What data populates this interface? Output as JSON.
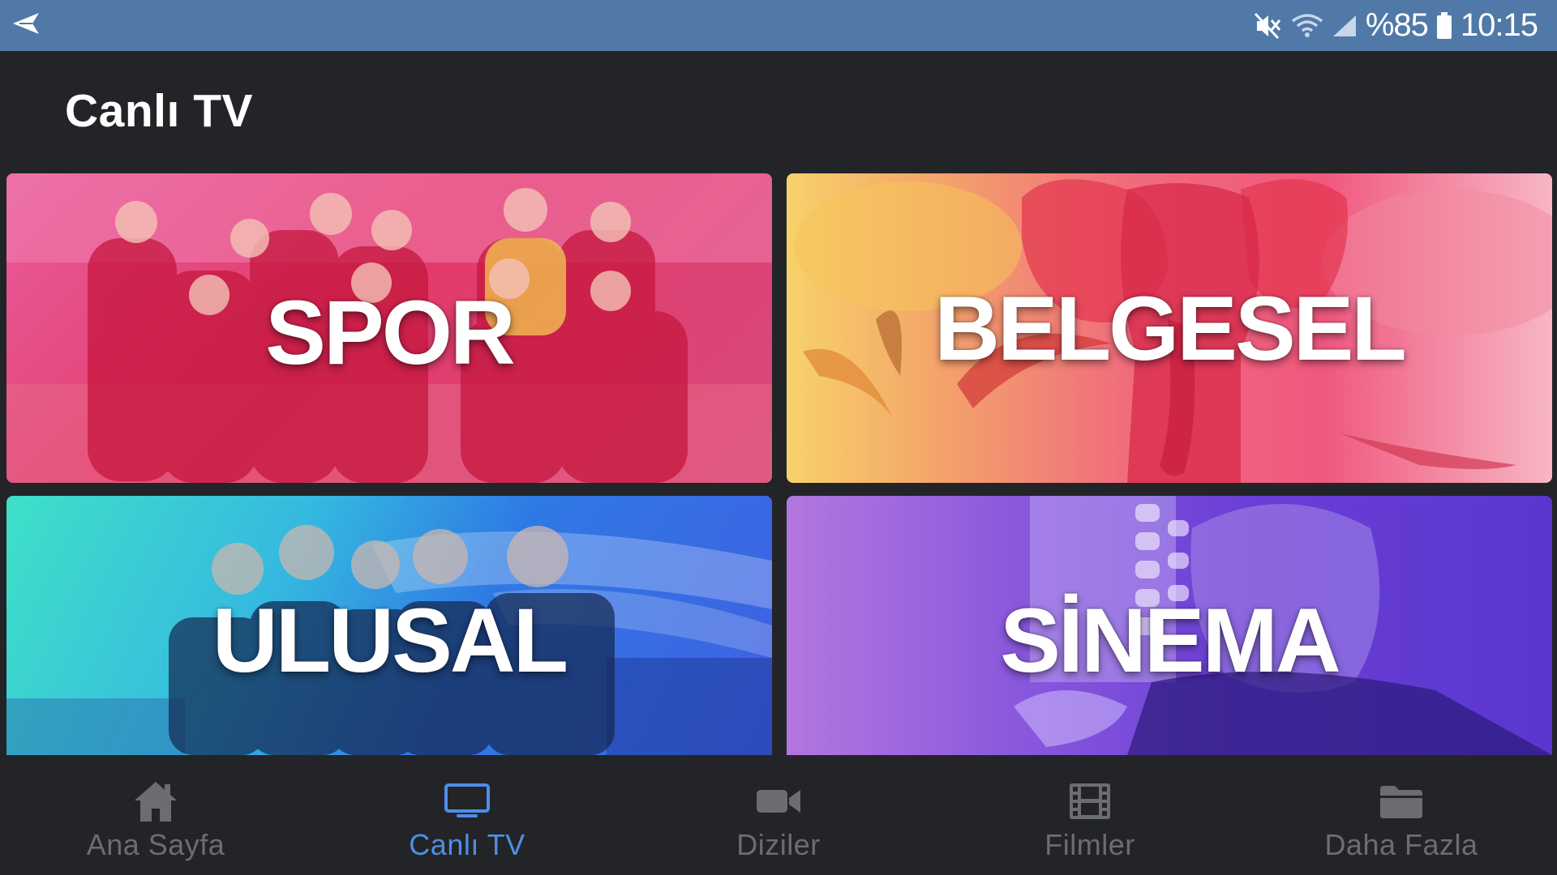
{
  "status_bar": {
    "back_icon": "send-arrow-icon",
    "battery_percent": "%85",
    "time": "10:15",
    "icons": [
      "mute-icon",
      "wifi-icon",
      "signal-icon",
      "battery-icon"
    ]
  },
  "page": {
    "title": "Canlı TV"
  },
  "categories": [
    {
      "label": "SPOR",
      "color": "#e33a6a"
    },
    {
      "label": "BELGESEL",
      "color": "#f0587e"
    },
    {
      "label": "ULUSAL",
      "color": "#2f79e4"
    },
    {
      "label": "SİNEMA",
      "color": "#6a3fd6"
    }
  ],
  "bottom_nav": {
    "active_color": "#4e8ee6",
    "inactive_color": "#6b6d73",
    "items": [
      {
        "label": "Ana Sayfa",
        "icon": "home-icon",
        "active": false
      },
      {
        "label": "Canlı TV",
        "icon": "tv-icon",
        "active": true
      },
      {
        "label": "Diziler",
        "icon": "video-camera-icon",
        "active": false
      },
      {
        "label": "Filmler",
        "icon": "film-icon",
        "active": false
      },
      {
        "label": "Daha Fazla",
        "icon": "folder-icon",
        "active": false
      }
    ]
  }
}
